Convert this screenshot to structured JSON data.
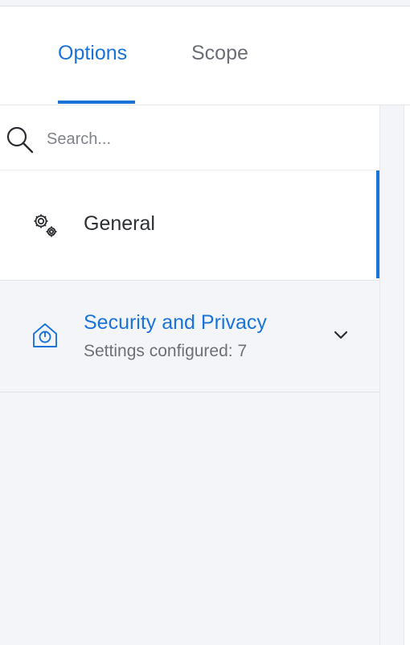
{
  "tabs": [
    {
      "label": "Options",
      "active": true
    },
    {
      "label": "Scope",
      "active": false
    }
  ],
  "search": {
    "placeholder": "Search...",
    "value": "",
    "icon": "search-icon"
  },
  "sidebar": {
    "items": [
      {
        "label": "General",
        "icon": "gears-icon",
        "active": true
      },
      {
        "label": "Security and Privacy",
        "sublabel": "Settings configured: 7",
        "icon": "security-house-icon",
        "expandable": true
      }
    ]
  },
  "colors": {
    "accent": "#1a73d9",
    "background": "#f4f5f8"
  }
}
